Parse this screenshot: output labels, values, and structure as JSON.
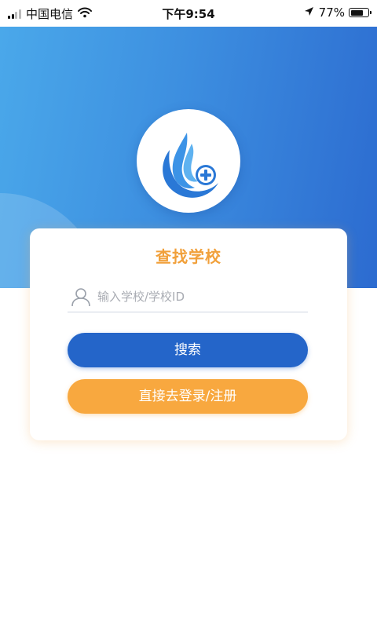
{
  "status_bar": {
    "carrier": "中国电信",
    "time": "下午9:54",
    "battery_percent": "77%",
    "battery_level": 0.77,
    "icons": [
      "signal-icon",
      "wifi-icon",
      "location-arrow-icon",
      "battery-icon"
    ]
  },
  "header": {
    "logo_icon": "water-drop-plus-icon"
  },
  "card": {
    "title": "查找学校",
    "search": {
      "icon": "user-icon",
      "value": "",
      "placeholder": "输入学校/学校ID"
    },
    "search_button_label": "搜索",
    "login_button_label": "直接去登录/注册"
  },
  "colors": {
    "header_gradient_start": "#4aa8ea",
    "header_gradient_end": "#2c6bd0",
    "title_orange": "#f1a03a",
    "search_button_blue": "#2465c9",
    "login_button_orange": "#f8a83f"
  }
}
